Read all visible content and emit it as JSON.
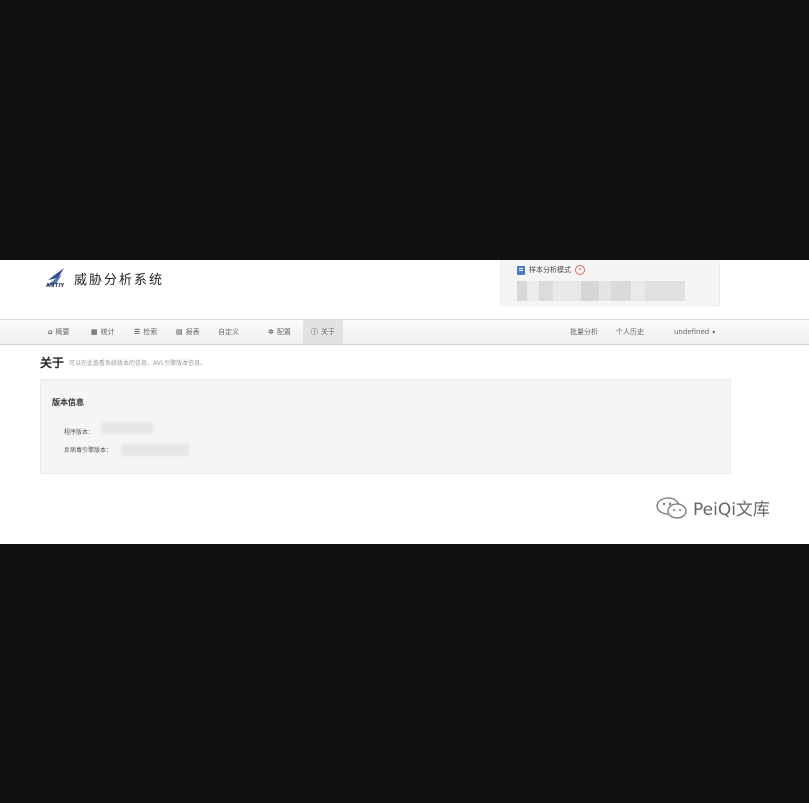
{
  "header": {
    "logo_caption": "ANTIY",
    "app_title": "威胁分析系统",
    "mode_label": "样本分析模式",
    "mode_icon": "document-icon",
    "toggle_icon": "toggle-icon",
    "toggle_text": "✕"
  },
  "navbar": {
    "left_items": [
      {
        "icon": "home-icon",
        "glyph": "⌂",
        "label": "概要"
      },
      {
        "icon": "stats-icon",
        "glyph": "▦",
        "label": "统计"
      },
      {
        "icon": "list-icon",
        "glyph": "☰",
        "label": "检索"
      },
      {
        "icon": "report-icon",
        "glyph": "▤",
        "label": "报表"
      },
      {
        "icon": "",
        "glyph": "",
        "label": "自定义"
      },
      {
        "icon": "gear-icon",
        "glyph": "✲",
        "label": "配置"
      },
      {
        "icon": "info-icon",
        "glyph": "ⓘ",
        "label": "关于",
        "active": true
      }
    ],
    "right_items": [
      {
        "label": "批量分析"
      },
      {
        "label": "个人历史"
      },
      {
        "label": "undefined",
        "dropdown": true
      }
    ],
    "caret": "▾"
  },
  "page": {
    "title": "关于",
    "subtitle": "可以在此查看系统版本的信息、AVL引擎版本信息。"
  },
  "panel": {
    "title": "版本信息",
    "program_version_label": "程序版本：",
    "engine_version_label": "反病毒引擎版本："
  },
  "watermark": {
    "icon": "wechat-icon",
    "text": "PeiQi文库"
  },
  "colors": {
    "background": "#111111",
    "accent": "#4a7bc8",
    "panel": "#f5f5f5"
  }
}
